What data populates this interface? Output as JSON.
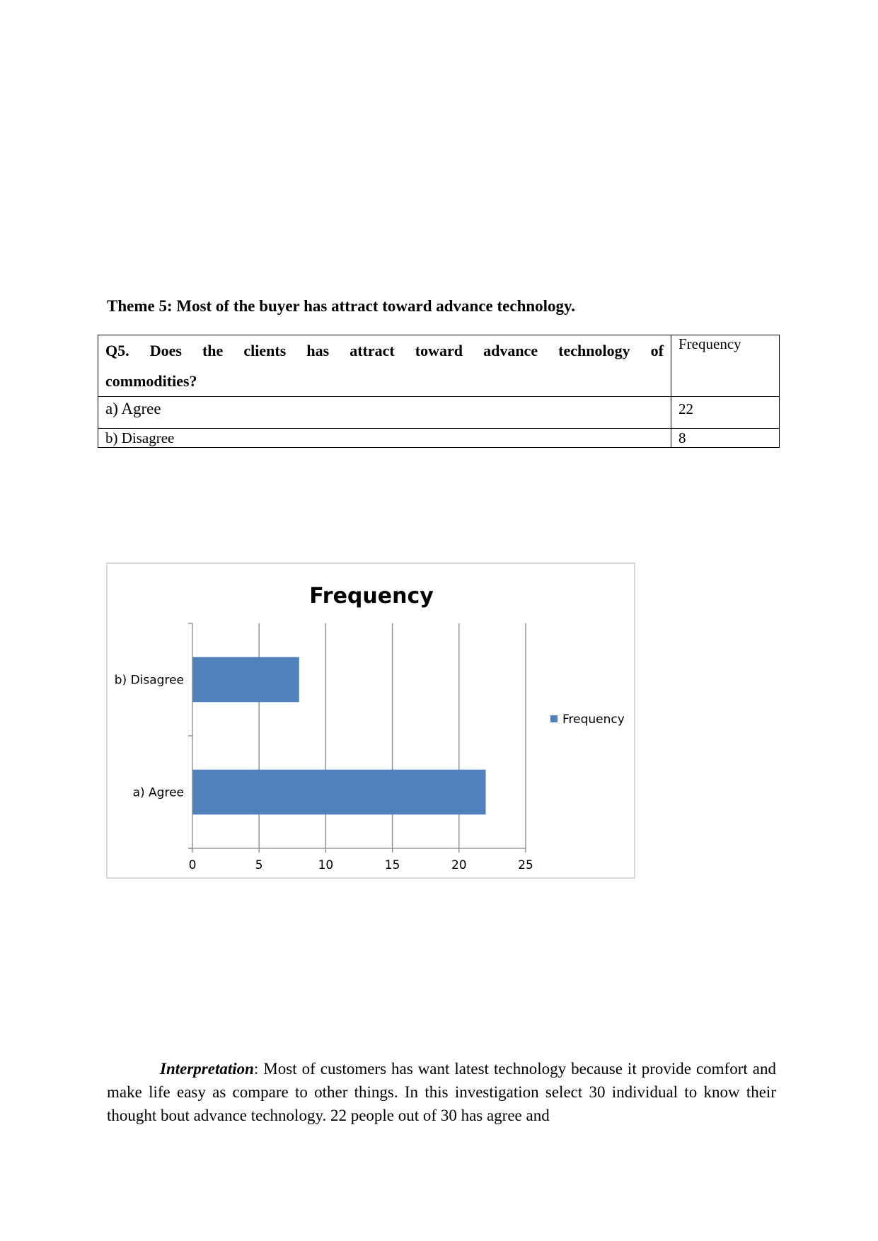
{
  "heading": "Theme 5: Most of the buyer has attract toward advance technology.",
  "table": {
    "question_line1": "Q5. Does the clients has attract toward advance technology of",
    "question_line2": "commodities?",
    "frequency_header": "Frequency",
    "rows": [
      {
        "label": "a) Agree",
        "value": "22"
      },
      {
        "label": "b) Disagree",
        "value": "8"
      }
    ]
  },
  "chart_data": {
    "type": "bar",
    "orientation": "horizontal",
    "title": "Frequency",
    "categories": [
      "a) Agree",
      "b) Disagree"
    ],
    "series": [
      {
        "name": "Frequency",
        "values": [
          22,
          8
        ],
        "color": "#4f81bd"
      }
    ],
    "xlim": [
      0,
      25
    ],
    "xticks": [
      "0",
      "5",
      "10",
      "15",
      "20",
      "25"
    ],
    "xlabel": "",
    "ylabel": "",
    "grid": true,
    "legend": "right",
    "legend_entries": [
      "Frequency"
    ]
  },
  "interpretation": {
    "lead": "Interpretation",
    "text": ": Most of customers has want latest technology because it provide comfort and make life easy as compare to other things. In this investigation select 30 individual to know their thought bout advance technology. 22 people out of 30 has agree and"
  }
}
